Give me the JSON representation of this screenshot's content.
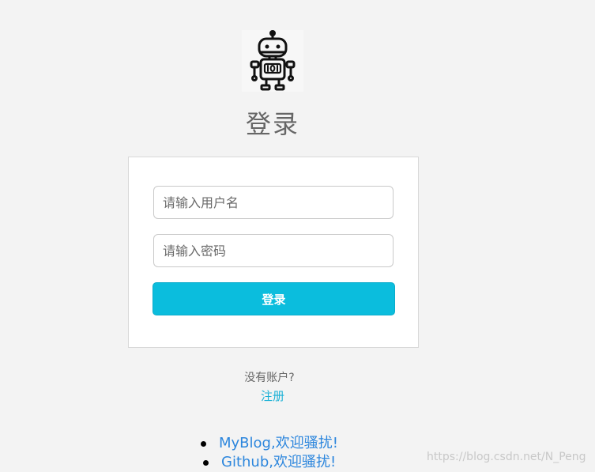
{
  "logo": {
    "icon": "robot-icon"
  },
  "header": {
    "title": "登录"
  },
  "form": {
    "username_placeholder": "请输入用户名",
    "password_placeholder": "请输入密码",
    "submit_label": "登录"
  },
  "footer": {
    "no_account_text": "没有账户?",
    "register_link": "注册"
  },
  "links": [
    {
      "label": "MyBlog,欢迎骚扰!"
    },
    {
      "label": "Github,欢迎骚扰!"
    }
  ],
  "watermark": "https://blog.csdn.net/N_Peng",
  "colors": {
    "accent": "#0bbddd",
    "link": "#2c86dd",
    "register": "#1bb1d6",
    "background": "#f3f3f3"
  }
}
